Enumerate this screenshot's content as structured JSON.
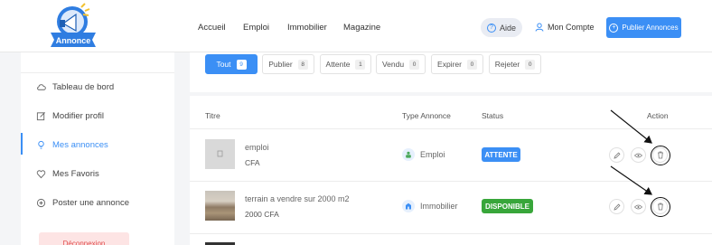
{
  "header": {
    "logo_text": "Annonce",
    "nav": [
      "Accueil",
      "Emploi",
      "Immobilier",
      "Magazine"
    ],
    "aide_label": "Aide",
    "compte_label": "Mon Compte",
    "publier_label": "Publier Annonces",
    "accent_color": "#3b8ff5"
  },
  "sidebar": {
    "items": [
      {
        "label": "Tableau de bord",
        "icon": "cloud-icon"
      },
      {
        "label": "Modifier profil",
        "icon": "edit-icon"
      },
      {
        "label": "Mes annonces",
        "icon": "bulb-icon",
        "active": true
      },
      {
        "label": "Mes Favoris",
        "icon": "heart-icon"
      },
      {
        "label": "Poster une annonce",
        "icon": "plus-circle-icon"
      }
    ],
    "logout_label": "Déconnexion"
  },
  "tabs": [
    {
      "label": "Tout",
      "count": "9",
      "active": true
    },
    {
      "label": "Publier",
      "count": "8"
    },
    {
      "label": "Attente",
      "count": "1"
    },
    {
      "label": "Vendu",
      "count": "0"
    },
    {
      "label": "Expirer",
      "count": "0"
    },
    {
      "label": "Rejeter",
      "count": "0"
    }
  ],
  "table": {
    "headers": {
      "title": "Titre",
      "type": "Type Annonce",
      "status": "Status",
      "action": "Action"
    },
    "rows": [
      {
        "title": "emploi",
        "price": "CFA",
        "type": "Emploi",
        "status": "ATTENTE",
        "status_color": "#3b8ff5"
      },
      {
        "title": "terrain a vendre sur 2000 m2",
        "price": "2000 CFA",
        "type": "Immobilier",
        "status": "DISPONIBLE",
        "status_color": "#38a63a"
      }
    ]
  }
}
